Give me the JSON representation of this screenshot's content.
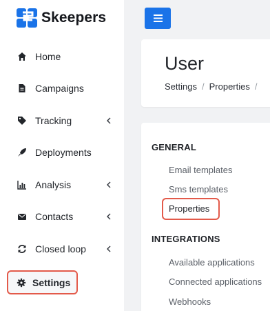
{
  "brand": {
    "name": "Skeepers",
    "color": "#1a73e8"
  },
  "topbar": {
    "menu_icon": "hamburger-icon"
  },
  "sidebar": {
    "items": [
      {
        "label": "Home",
        "icon": "home-icon",
        "has_caret": false
      },
      {
        "label": "Campaigns",
        "icon": "document-icon",
        "has_caret": false
      },
      {
        "label": "Tracking",
        "icon": "tag-icon",
        "has_caret": true
      },
      {
        "label": "Deployments",
        "icon": "rocket-icon",
        "has_caret": false
      },
      {
        "label": "Analysis",
        "icon": "bar-chart-icon",
        "has_caret": true
      },
      {
        "label": "Contacts",
        "icon": "envelope-icon",
        "has_caret": true
      },
      {
        "label": "Closed loop",
        "icon": "refresh-icon",
        "has_caret": true
      },
      {
        "label": "Settings",
        "icon": "gear-icon",
        "has_caret": false,
        "highlighted": true
      }
    ]
  },
  "header": {
    "title": "User",
    "breadcrumb": [
      "Settings",
      "Properties"
    ],
    "breadcrumb_separator": "/"
  },
  "content": {
    "general": {
      "title": "GENERAL",
      "links": [
        "Email templates",
        "Sms templates",
        "Properties"
      ]
    },
    "integrations": {
      "title": "INTEGRATIONS",
      "links": [
        "Available applications",
        "Connected applications",
        "Webhooks"
      ]
    }
  },
  "colors": {
    "accent": "#1a73e8",
    "highlight_border": "#e35a4a"
  }
}
